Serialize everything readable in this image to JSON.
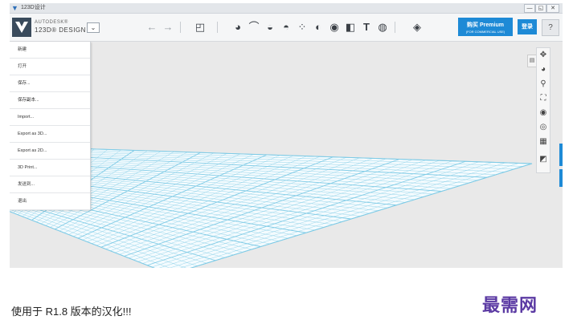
{
  "window": {
    "title": "123D设计",
    "controls": [
      "—",
      "◱",
      "✕"
    ]
  },
  "toolbar": {
    "brand_line1": "AUTODESK®",
    "brand_line2": "123D® DESIGN",
    "menu_arrow": "⌄",
    "undo": "←",
    "redo": "→",
    "premium_label": "购买 Premium",
    "premium_sub": "(FOR COMMERCIAL USE)",
    "signin_label": "登录",
    "help_label": "?"
  },
  "file_menu": {
    "items": [
      {
        "label": "新建"
      },
      {
        "label": "打开"
      },
      {
        "label": "保存..."
      },
      {
        "label": "保存副本..."
      },
      {
        "label": "Import..."
      },
      {
        "label": "Export as 3D..."
      },
      {
        "label": "Export as 2D..."
      },
      {
        "label": "3D Print..."
      },
      {
        "label": "发送到..."
      },
      {
        "label": "退出"
      }
    ]
  },
  "view_toolbar": {
    "icons": [
      "pan-icon",
      "orbit-icon",
      "zoom-icon",
      "fit-icon",
      "views-icon",
      "visibility-icon",
      "material-icon",
      "snap-icon"
    ]
  },
  "caption": "使用于 R1.8 版本的汉化!!!",
  "watermark": "最需网",
  "colors": {
    "accent": "#1e8ad6",
    "grid": "#7fcbe6",
    "watermark": "#5b3aa3"
  }
}
